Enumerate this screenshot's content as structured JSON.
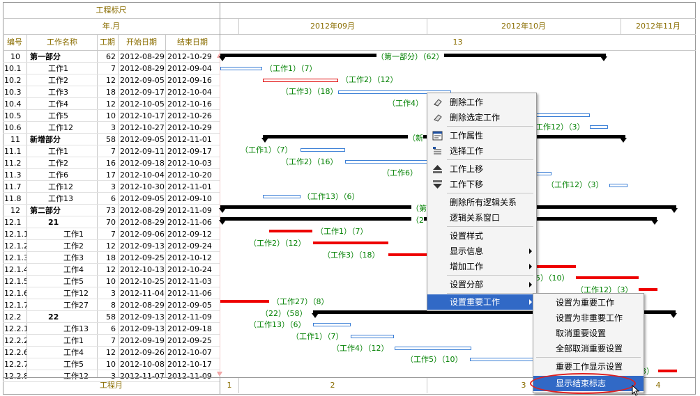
{
  "header": {
    "ruler_title": "工程标尺",
    "year_month": "年.月",
    "months": [
      "2012年09月",
      "2012年10月",
      "2012年11月"
    ],
    "week_label": "13",
    "footer_label": "工程月",
    "footer_numbers": [
      "1",
      "2",
      "3",
      "4"
    ]
  },
  "columns": {
    "id": "编号",
    "name": "工作名称",
    "days": "工期",
    "start": "开始日期",
    "end": "结束日期"
  },
  "rows": [
    {
      "id": "10",
      "name": "第一部分",
      "days": "62",
      "start": "2012-08-29",
      "end": "2012-10-29",
      "bold": true,
      "indent": 0
    },
    {
      "id": "10.1",
      "name": "工作1",
      "days": "7",
      "start": "2012-08-29",
      "end": "2012-09-04",
      "indent": 1
    },
    {
      "id": "10.2",
      "name": "工作2",
      "days": "12",
      "start": "2012-09-05",
      "end": "2012-09-16",
      "indent": 1
    },
    {
      "id": "10.3",
      "name": "工作3",
      "days": "18",
      "start": "2012-09-17",
      "end": "2012-10-04",
      "indent": 1
    },
    {
      "id": "10.4",
      "name": "工作4",
      "days": "12",
      "start": "2012-10-05",
      "end": "2012-10-16",
      "indent": 1
    },
    {
      "id": "10.5",
      "name": "工作5",
      "days": "10",
      "start": "2012-10-17",
      "end": "2012-10-26",
      "indent": 1
    },
    {
      "id": "10.6",
      "name": "工作12",
      "days": "3",
      "start": "2012-10-27",
      "end": "2012-10-29",
      "indent": 1
    },
    {
      "id": "11",
      "name": "新增部分",
      "days": "58",
      "start": "2012-09-05",
      "end": "2012-11-01",
      "bold": true,
      "indent": 0
    },
    {
      "id": "11.1",
      "name": "工作1",
      "days": "7",
      "start": "2012-09-11",
      "end": "2012-09-17",
      "indent": 1
    },
    {
      "id": "11.2",
      "name": "工作2",
      "days": "16",
      "start": "2012-09-18",
      "end": "2012-10-03",
      "indent": 1
    },
    {
      "id": "11.3",
      "name": "工作6",
      "days": "17",
      "start": "2012-10-04",
      "end": "2012-10-20",
      "indent": 1
    },
    {
      "id": "11.7",
      "name": "工作12",
      "days": "3",
      "start": "2012-10-30",
      "end": "2012-11-01",
      "indent": 1
    },
    {
      "id": "11.8",
      "name": "工作13",
      "days": "6",
      "start": "2012-09-05",
      "end": "2012-09-10",
      "indent": 1
    },
    {
      "id": "12",
      "name": "第二部分",
      "days": "73",
      "start": "2012-08-29",
      "end": "2012-11-09",
      "bold": true,
      "indent": 0
    },
    {
      "id": "12.1",
      "name": "21",
      "days": "70",
      "start": "2012-08-29",
      "end": "2012-11-06",
      "bold": true,
      "indent": 2
    },
    {
      "id": "12.1.1",
      "name": "工作1",
      "days": "7",
      "start": "2012-09-06",
      "end": "2012-09-12",
      "indent": 3
    },
    {
      "id": "12.1.2",
      "name": "工作2",
      "days": "12",
      "start": "2012-09-13",
      "end": "2012-09-24",
      "indent": 3
    },
    {
      "id": "12.1.3",
      "name": "工作3",
      "days": "18",
      "start": "2012-09-25",
      "end": "2012-10-12",
      "indent": 3
    },
    {
      "id": "12.1.4",
      "name": "工作4",
      "days": "12",
      "start": "2012-10-13",
      "end": "2012-10-24",
      "indent": 3
    },
    {
      "id": "12.1.5",
      "name": "工作5",
      "days": "10",
      "start": "2012-10-25",
      "end": "2012-11-03",
      "indent": 3
    },
    {
      "id": "12.1.6",
      "name": "工作12",
      "days": "3",
      "start": "2012-11-04",
      "end": "2012-11-06",
      "indent": 3
    },
    {
      "id": "12.1.7",
      "name": "工作27",
      "days": "8",
      "start": "2012-08-29",
      "end": "2012-09-05",
      "indent": 3
    },
    {
      "id": "12.2",
      "name": "22",
      "days": "58",
      "start": "2012-09-13",
      "end": "2012-11-09",
      "bold": true,
      "indent": 2
    },
    {
      "id": "12.2.1",
      "name": "工作13",
      "days": "6",
      "start": "2012-09-13",
      "end": "2012-09-18",
      "indent": 3
    },
    {
      "id": "12.2.2",
      "name": "工作1",
      "days": "7",
      "start": "2012-09-19",
      "end": "2012-09-25",
      "indent": 3
    },
    {
      "id": "12.2.6",
      "name": "工作4",
      "days": "12",
      "start": "2012-09-26",
      "end": "2012-10-07",
      "indent": 3
    },
    {
      "id": "12.2.7",
      "name": "工作5",
      "days": "10",
      "start": "2012-10-08",
      "end": "2012-10-17",
      "indent": 3
    },
    {
      "id": "12.2.8",
      "name": "工作12",
      "days": "3",
      "start": "2012-11-07",
      "end": "2012-11-09",
      "indent": 3
    }
  ],
  "gantt_labels": {
    "r0": "（第一部分）（62）",
    "r1": "（工作1）（7）",
    "r2": "（工作2）（12）",
    "r3": "（工作3）（18）",
    "r4": "（工作4）",
    "r6": "工作12）（3）",
    "r7": "（新",
    "r8": "（工作1）（7）",
    "r9": "（工作2）（16）",
    "r10": "（工作6）",
    "r11": "（工作12）（3）",
    "r12": "（工作13）（6）",
    "r13": "（第",
    "r14": "（2",
    "r15": "（工作1）（7）",
    "r16": "（工作2）（12）",
    "r17": "（工作3）（18）",
    "r19": "5）（10）",
    "r20": "（工作12）（3）",
    "r21": "（工作27）（8）",
    "r22": "（22）（58）",
    "r23": "（工作13）（6）",
    "r24": "（工作1）（7）",
    "r25": "（工作4）（12）",
    "r26": "（工作5）（10）",
    "r27": "3）"
  },
  "context_menu": {
    "items": [
      {
        "label": "删除工作",
        "icon": "eraser-icon"
      },
      {
        "label": "删除选定工作",
        "icon": "eraser-icon"
      },
      {
        "label": "工作属性",
        "icon": "properties-icon"
      },
      {
        "label": "选择工作",
        "icon": "select-icon"
      },
      {
        "label": "工作上移",
        "icon": "move-up-icon"
      },
      {
        "label": "工作下移",
        "icon": "move-down-icon"
      },
      {
        "label": "删除所有逻辑关系"
      },
      {
        "label": "逻辑关系窗口"
      },
      {
        "label": "设置样式"
      },
      {
        "label": "显示信息",
        "submenu": true
      },
      {
        "label": "增加工作",
        "submenu": true
      },
      {
        "label": "设置分部",
        "submenu": true
      },
      {
        "label": "设置重要工作",
        "submenu": true,
        "highlighted": true
      }
    ],
    "submenu": [
      {
        "label": "设置为重要工作"
      },
      {
        "label": "设置为非重要工作"
      },
      {
        "label": "取消重要设置"
      },
      {
        "label": "全部取消重要设置"
      },
      {
        "label": "重要工作显示设置"
      },
      {
        "label": "显示结束标志",
        "highlighted": true
      }
    ]
  },
  "colors": {
    "header_text": "#8a6d00",
    "gantt_text": "#008000",
    "highlight": "#3169c6",
    "critical_bar": "#ee0000",
    "normal_bar": "#3b7fd6"
  }
}
